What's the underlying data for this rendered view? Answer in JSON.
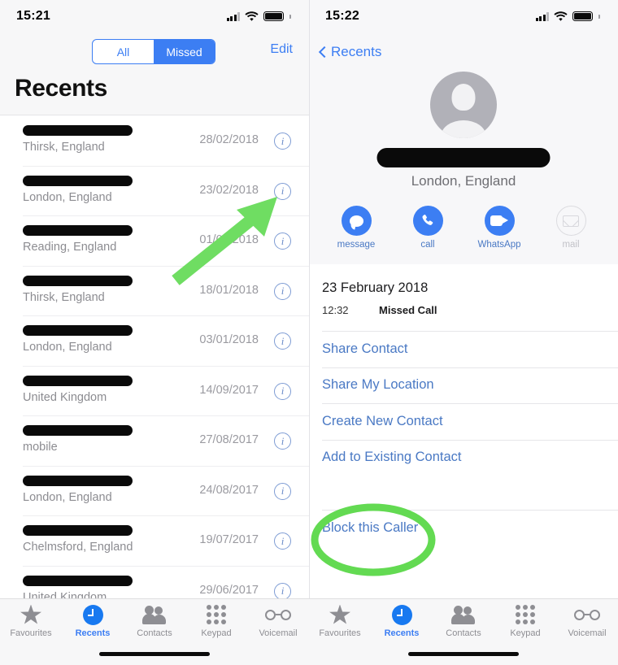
{
  "left": {
    "status": {
      "time": "15:21"
    },
    "segmented": {
      "options": [
        "All",
        "Missed"
      ],
      "selected": "Missed"
    },
    "edit_label": "Edit",
    "title": "Recents",
    "calls": [
      {
        "name_redacted": true,
        "name_width": 135,
        "location": "Thirsk, England",
        "date": "28/02/2018",
        "info": "i"
      },
      {
        "name_redacted": true,
        "name_width": 135,
        "location": "London, England",
        "date": "23/02/2018",
        "info": "i"
      },
      {
        "name_redacted": true,
        "name_width": 135,
        "location": "Reading, England",
        "date": "01/02/2018",
        "info": "i"
      },
      {
        "name_redacted": true,
        "name_width": 135,
        "location": "Thirsk, England",
        "date": "18/01/2018",
        "info": "i"
      },
      {
        "name_redacted": true,
        "name_width": 135,
        "location": "London, England",
        "date": "03/01/2018",
        "info": "i"
      },
      {
        "name_redacted": true,
        "name_width": 135,
        "location": "United Kingdom",
        "date": "14/09/2017",
        "info": "i"
      },
      {
        "name_redacted": true,
        "name_width": 135,
        "location": "mobile",
        "date": "27/08/2017",
        "info": "i"
      },
      {
        "name_redacted": true,
        "name_width": 135,
        "location": "London, England",
        "date": "24/08/2017",
        "info": "i"
      },
      {
        "name_redacted": true,
        "name_width": 135,
        "location": "Chelmsford, England",
        "date": "19/07/2017",
        "info": "i"
      },
      {
        "name_redacted": true,
        "name_width": 135,
        "location": "United Kingdom",
        "date": "29/06/2017",
        "info": "i"
      }
    ],
    "tabs": [
      {
        "label": "Favourites",
        "icon": "star-icon",
        "active": false
      },
      {
        "label": "Recents",
        "icon": "clock-icon",
        "active": true
      },
      {
        "label": "Contacts",
        "icon": "people-icon",
        "active": false
      },
      {
        "label": "Keypad",
        "icon": "keypad-icon",
        "active": false
      },
      {
        "label": "Voicemail",
        "icon": "voicemail-icon",
        "active": false
      }
    ]
  },
  "right": {
    "status": {
      "time": "15:22"
    },
    "back_label": "Recents",
    "contact": {
      "name_redacted": true,
      "location": "London, England"
    },
    "actions": [
      {
        "label": "message",
        "icon": "message-bubble-icon",
        "disabled": false
      },
      {
        "label": "call",
        "icon": "phone-icon",
        "disabled": false
      },
      {
        "label": "WhatsApp",
        "icon": "video-camera-icon",
        "disabled": false
      },
      {
        "label": "mail",
        "icon": "envelope-icon",
        "disabled": true
      }
    ],
    "detail": {
      "date": "23 February 2018",
      "time": "12:32",
      "type": "Missed Call"
    },
    "options": [
      {
        "label": "Share Contact"
      },
      {
        "label": "Share My Location"
      },
      {
        "label": "Create New Contact"
      },
      {
        "label": "Add to Existing Contact"
      }
    ],
    "block_option": {
      "label": "Block this Caller"
    },
    "tabs": [
      {
        "label": "Favourites",
        "icon": "star-icon",
        "active": false
      },
      {
        "label": "Recents",
        "icon": "clock-icon",
        "active": true
      },
      {
        "label": "Contacts",
        "icon": "people-icon",
        "active": false
      },
      {
        "label": "Keypad",
        "icon": "keypad-icon",
        "active": false
      },
      {
        "label": "Voicemail",
        "icon": "voicemail-icon",
        "active": false
      }
    ]
  },
  "annotations": {
    "arrow": {
      "color": "#6fdd62",
      "points_to": "info-button-row-2"
    },
    "ellipse": {
      "color": "#63da52",
      "encircles": "Block this Caller"
    }
  },
  "colors": {
    "accent_blue": "#3c7ef3",
    "annotation_green": "#6fdd62",
    "redaction_black": "#0a0a0a"
  }
}
